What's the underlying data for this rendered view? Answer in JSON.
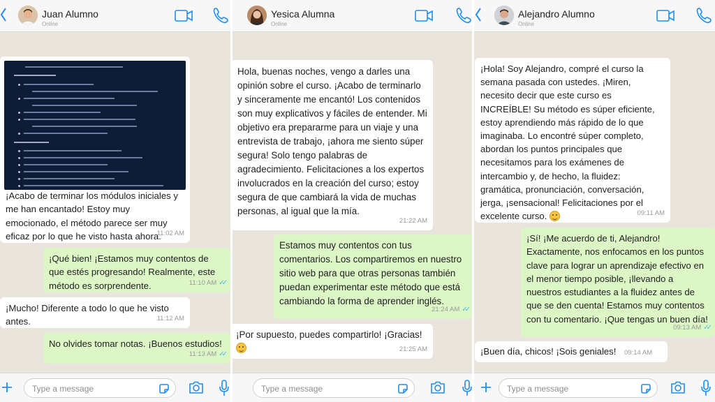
{
  "app": {
    "accent": "#1f8ef1",
    "tick_color": "#4fb6ec",
    "incoming_bg": "#ffffff",
    "outgoing_bg": "#dcf6c6",
    "wallpaper": "#e9e4dc"
  },
  "chats": [
    {
      "contact": {
        "name": "Juan Alumno",
        "status": "Online"
      },
      "input_placeholder": "Type a message",
      "messages": [
        {
          "dir": "in",
          "has_image": true,
          "text": "¡Acabo de terminar los módulos iniciales y me han encantado! Estoy muy emocionado, el método parece ser muy eficaz por lo que he visto hasta ahora.",
          "time": "11:02 AM"
        },
        {
          "dir": "out",
          "text": "¡Qué bien! ¡Estamos muy contentos de que estés progresando! Realmente, este método es sorprendente.",
          "time": "11:10 AM",
          "read": true
        },
        {
          "dir": "in",
          "text": "¡Mucho! Diferente a todo lo que he visto antes.",
          "time": "11:12 AM"
        },
        {
          "dir": "out",
          "text": "No olvides tomar notas. ¡Buenos estudios!",
          "time": "11:13 AM",
          "read": true
        }
      ]
    },
    {
      "contact": {
        "name": "Yesica Alumna",
        "status": "Online"
      },
      "input_placeholder": "Type a message",
      "messages": [
        {
          "dir": "in",
          "text": "Hola, buenas noches, vengo a darles una opinión sobre el curso. ¡Acabo de terminarlo y sinceramente me encantó! Los contenidos son muy explicativos y fáciles de entender. Mi objetivo era prepararme para un viaje y una entrevista de trabajo, ¡ahora me siento súper segura! Solo tengo palabras de agradecimiento. Felicitaciones a los expertos involucrados en la creación del curso; estoy segura de que cambiará la vida de muchas personas, al igual que la mía.",
          "time": "21:22 AM"
        },
        {
          "dir": "out",
          "text": "Estamos muy contentos con tus comentarios. Los compartiremos en nuestro sitio web para que otras personas también puedan experimentar este método que está cambiando la forma de aprender inglés.",
          "time": "21:24 AM",
          "read": true
        },
        {
          "dir": "in",
          "text": "¡Por supuesto, puedes compartirlo! ¡Gracias!",
          "emoji": "smile-emoji",
          "time": "21:25 AM"
        }
      ]
    },
    {
      "contact": {
        "name": "Alejandro Alumno",
        "status": "Online"
      },
      "input_placeholder": "Type a message",
      "messages": [
        {
          "dir": "in",
          "text": "¡Hola! Soy Alejandro, compré el curso la semana pasada con ustedes. ¡Miren, necesito decir que este curso es INCREÍBLE! Su método es súper eficiente, estoy aprendiendo más rápido de lo que imaginaba. Lo encontré súper completo, abordan los puntos principales que necesitamos para los exámenes de intercambio y, de hecho, la fluidez: gramática, pronunciación, conversación, jerga, ¡sensacional! Felicitaciones por el excelente curso.",
          "emoji": "grin-emoji",
          "time": "09:11 AM"
        },
        {
          "dir": "out",
          "text": "¡Sí! ¡Me acuerdo de ti, Alejandro! Exactamente, nos enfocamos en los puntos clave para lograr un aprendizaje efectivo en el menor tiempo posible, ¡llevando a nuestros estudiantes a la fluidez antes de que se den cuenta! Estamos muy contentos con tu comentario. ¡Que tengas un buen día!",
          "time": "09:13 AM",
          "read": true
        },
        {
          "dir": "in",
          "text": "¡Buen día, chicos! ¡Sois geniales!",
          "time": "09:14 AM"
        }
      ]
    }
  ]
}
